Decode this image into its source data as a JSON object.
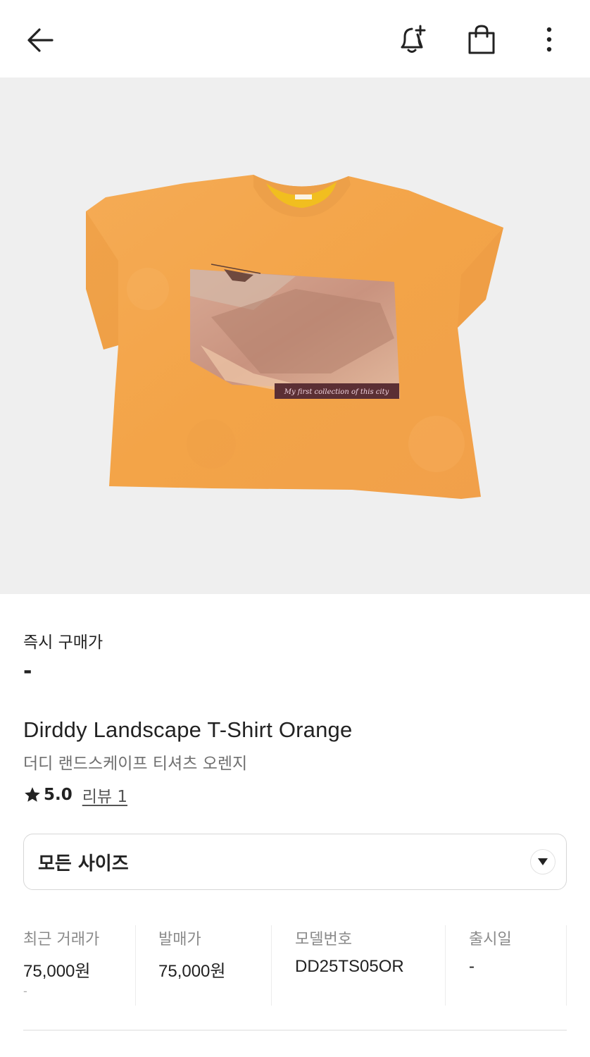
{
  "header": {
    "back_icon": "arrow-left-icon",
    "alert_icon": "bell-plus-icon",
    "bag_icon": "shopping-bag-icon",
    "more_icon": "more-vertical-icon"
  },
  "product_image": {
    "print_caption": "My first collection of this city",
    "neck_tag": "DIRDDY",
    "colors": {
      "background": "#efefef",
      "shirt": "#f4a64d",
      "collar": "#f3a651",
      "inner_tag": "#f1be1f"
    }
  },
  "price": {
    "label": "즉시 구매가",
    "value": "-"
  },
  "product": {
    "title_en": "Dirddy Landscape T-Shirt Orange",
    "title_ko": "더디 랜드스케이프 티셔츠 오렌지",
    "rating": "5.0",
    "review_label": "리뷰 1"
  },
  "size_select": {
    "label": "모든 사이즈",
    "icon": "triangle-down-icon"
  },
  "info": [
    {
      "key": "최근 거래가",
      "value": "75,000원",
      "sub": "-"
    },
    {
      "key": "발매가",
      "value": "75,000원",
      "sub": ""
    },
    {
      "key": "모델번호",
      "value": "DD25TS05OR",
      "sub": ""
    },
    {
      "key": "출시일",
      "value": "-",
      "sub": ""
    }
  ]
}
